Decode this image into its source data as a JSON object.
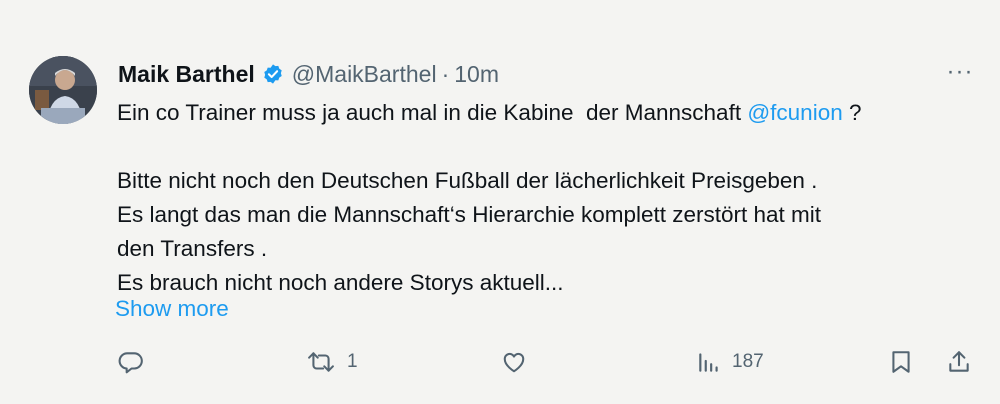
{
  "tweet": {
    "author_name": "Maik Barthel",
    "handle": "@MaikBarthel",
    "separator": "·",
    "time": "10m",
    "more_label": "···",
    "line1_before": "Ein co Trainer muss ja auch mal in die Kabine  der Mannschaft ",
    "mention": "@fcunion",
    "line1_after": " ?",
    "line2": "Bitte nicht noch den Deutschen Fußball der lächerlichkeit Preisgeben .",
    "line3": "Es langt das man die Mannschaft‘s Hierarchie komplett zerstört hat mit",
    "line4": "den Transfers .",
    "line5": "Es brauch nicht noch andere Storys aktuell...",
    "show_more": "Show more"
  },
  "actions": {
    "reply_icon": "reply-icon",
    "retweet_icon": "retweet-icon",
    "retweet_count": "1",
    "like_icon": "like-icon",
    "views_icon": "views-icon",
    "views_count": "187",
    "bookmark_icon": "bookmark-icon",
    "share_icon": "share-icon"
  },
  "colors": {
    "background": "#f4f4f2",
    "text": "#0f1419",
    "muted": "#536471",
    "accent": "#1d9bf0"
  }
}
